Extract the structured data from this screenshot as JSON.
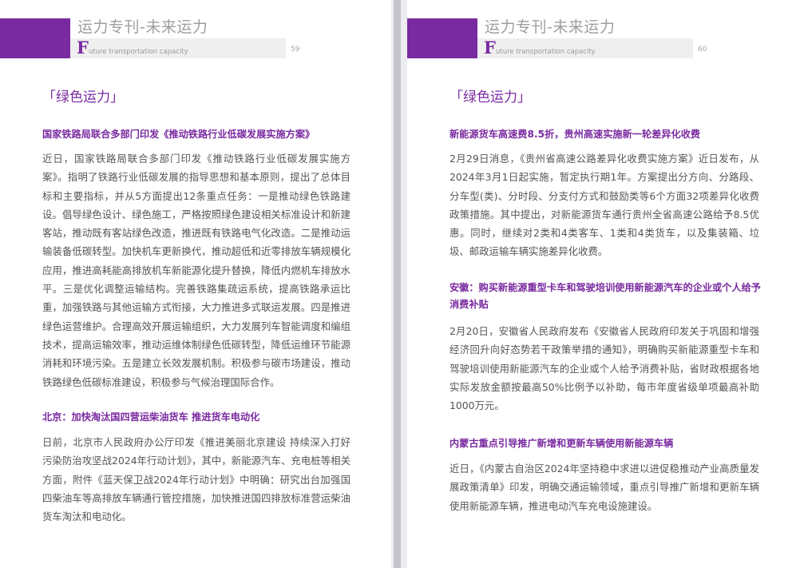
{
  "left_page": {
    "header_title": "运力专刊-未来运力",
    "header_sub_f": "F",
    "header_sub_rest": "uture transportation capacity",
    "page_number": "59",
    "section_title": "「绿色运力」",
    "articles": [
      {
        "title": "国家铁路局联合多部门印发《推动铁路行业低碳发展实施方案》",
        "body": "近日，国家铁路局联合多部门印发《推动铁路行业低碳发展实施方案》。指明了铁路行业低碳发展的指导思想和基本原则，提出了总体目标和主要指标，并从5方面提出12条重点任务：一是推动绿色铁路建设。倡导绿色设计、绿色施工，严格按照绿色建设相关标准设计和新建客站，推动既有客站绿色改造，推进既有铁路电气化改造。二是推动运输装备低碳转型。加快机车更新换代，推动超低和近零排放车辆规模化应用，推进高耗能高排放机车新能源化提升替换，降低内燃机车排放水平。三是优化调整运输结构。完善铁路集疏运系统，提高铁路承运比重，加强铁路与其他运输方式衔接，大力推进多式联运发展。四是推进绿色运营维护。合理高效开展运输组织，大力发展列车智能调度和编组技术，提高运输效率，推动运维体制绿色低碳转型，降低运维环节能源消耗和环境污染。五是建立长效发展机制。积极参与碳市场建设，推动铁路绿色低碳标准建设，积极参与气候治理国际合作。"
      },
      {
        "title": "北京：加快淘汰国四营运柴油货车 推进货车电动化",
        "body": "日前，北京市人民政府办公厅印发《推进美丽北京建设 持续深入打好污染防治攻坚战2024年行动计划》，其中，新能源汽车、充电桩等相关方面，附件《蓝天保卫战2024年行动计划》中明确：研究出台加强国四柴油车等高排放车辆通行管控措施，加快推进国四排放标准营运柴油货车淘汰和电动化。"
      }
    ]
  },
  "right_page": {
    "header_title": "运力专刊-未来运力",
    "header_sub_f": "F",
    "header_sub_rest": "uture transportation capacity",
    "page_number": "60",
    "section_title": "「绿色运力」",
    "articles": [
      {
        "title": "新能源货车高速费8.5折，贵州高速实施新一轮差异化收费",
        "body": "2月29日消息，《贵州省高速公路差异化收费实施方案》近日发布，从2024年3月1日起实施，暂定执行期1年。方案提出分方向、分路段、分车型(类)、分时段、分支付方式和鼓励类等6个方面32项差异化收费政策措施。其中提出，对新能源货车通行贵州全省高速公路给予8.5优惠。同时，继续对2类和4类客车、1类和4类货车，以及集装箱、垃圾、邮政运输车辆实施差异化收费。"
      },
      {
        "title": "安徽：购买新能源重型卡车和驾驶培训使用新能源汽车的企业或个人给予消费补贴",
        "body": "2月20日，安徽省人民政府发布《安徽省人民政府印发关于巩固和增强经济回升向好态势若干政策举措的通知》，明确购买新能源重型卡车和驾驶培训使用新能源汽车的企业或个人给予消费补贴，省财政根据各地实际发放金额按最高50%比例予以补助，每市年度省级单项最高补助1000万元。"
      },
      {
        "title": "内蒙古重点引导推广新增和更新车辆使用新能源车辆",
        "body": "近日，《内蒙古自治区2024年坚持稳中求进以进促稳推动产业高质量发展政策清单》印发，明确交通运输领域，重点引导推广新增和更新车辆使用新能源车辆，推进电动汽车充电设施建设。"
      }
    ]
  }
}
